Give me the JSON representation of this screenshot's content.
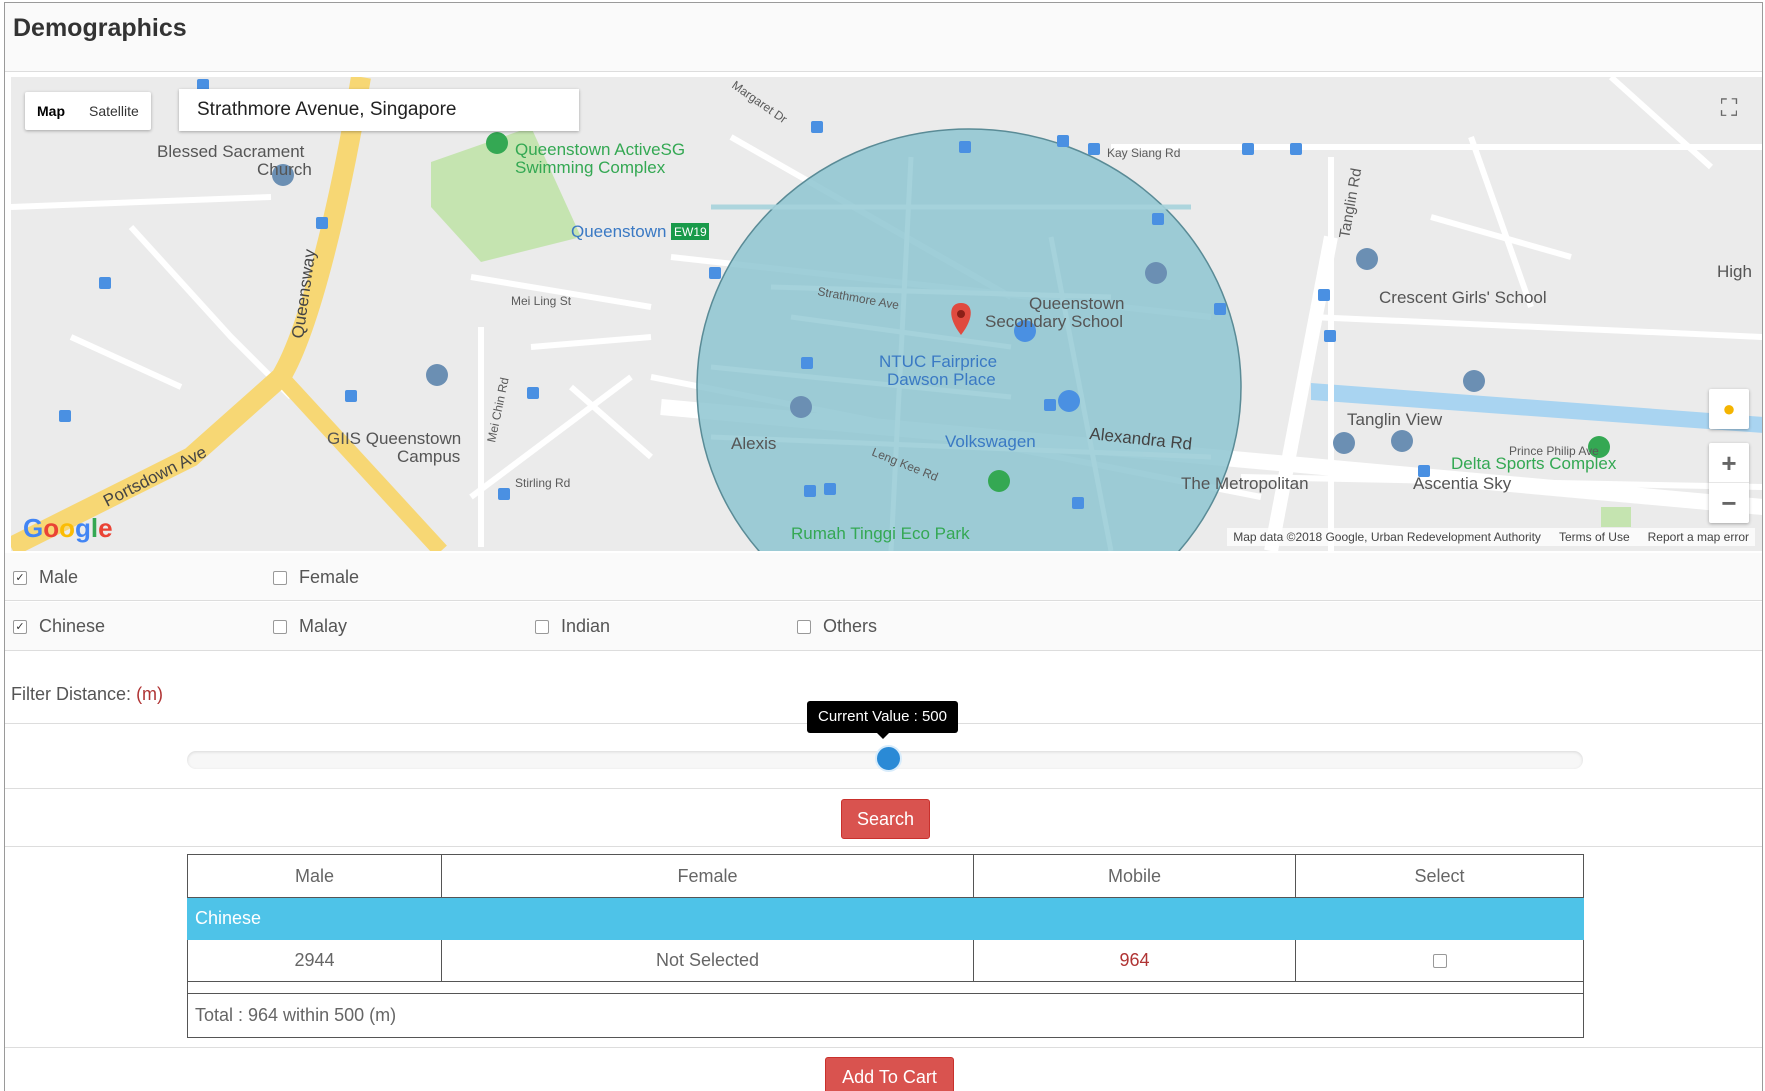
{
  "header": {
    "title": "Demographics"
  },
  "map": {
    "type_control": {
      "map": "Map",
      "satellite": "Satellite"
    },
    "search_value": "Strathmore Avenue, Singapore",
    "google_logo": "Google",
    "attribution": {
      "data": "Map data ©2018 Google, Urban Redevelopment Authority",
      "terms": "Terms of Use",
      "report": "Report a map error"
    },
    "places": {
      "p1": "Blessed Sacrament",
      "p1b": "Church",
      "p2": "Queenstown ActiveSG",
      "p2b": "Swimming Complex",
      "p3": "Queenstown",
      "p3_badge": "EW19",
      "p4": "Queenstown",
      "p4b": "Secondary School",
      "p5": "NTUC Fairprice",
      "p5b": "Dawson Place",
      "p6": "Crescent Girls' School",
      "p7": "GIIS Queenstown",
      "p7b": "Campus",
      "p8": "Alexis",
      "p9": "Volkswagen",
      "p10": "Tanglin View",
      "p11": "Delta Sports Complex",
      "p12": "The Metropolitan",
      "p13": "Ascentia Sky",
      "p14": "Rumah Tinggi Eco Park",
      "p15": "High"
    },
    "roads": {
      "queensway": "Queensway",
      "portsdown": "Portsdown Ave",
      "alexandra": "Alexandra Rd",
      "tanglin": "Tanglin Rd",
      "strathmore": "Strathmore Ave",
      "mei_ling": "Mei Ling St",
      "kay_siang": "Kay Siang Rd",
      "leng_kee": "Leng Kee Rd",
      "mei_chin": "Mei Chin Rd",
      "margaret": "Margaret Dr",
      "stirling": "Stirling Rd",
      "prince_philip": "Prince Philip Ave"
    }
  },
  "filters": {
    "gender": [
      {
        "label": "Male",
        "checked": true
      },
      {
        "label": "Female",
        "checked": false
      }
    ],
    "race": [
      {
        "label": "Chinese",
        "checked": true
      },
      {
        "label": "Malay",
        "checked": false
      },
      {
        "label": "Indian",
        "checked": false
      },
      {
        "label": "Others",
        "checked": false
      }
    ],
    "distance_label": "Filter Distance:",
    "distance_unit": "(m)",
    "slider_tooltip": "Current Value : 500",
    "slider_value": 500
  },
  "search_label": "Search",
  "results": {
    "headers": [
      "Male",
      "Female",
      "Mobile",
      "Select"
    ],
    "group": "Chinese",
    "row": {
      "male": "2944",
      "female": "Not Selected",
      "mobile": "964"
    },
    "total": "Total : 964 within 500 (m)"
  },
  "cart_label": "Add To Cart",
  "colors": {
    "accent_blue": "#4ec3e8",
    "button_red": "#d9534f",
    "value_red": "#b03434"
  }
}
